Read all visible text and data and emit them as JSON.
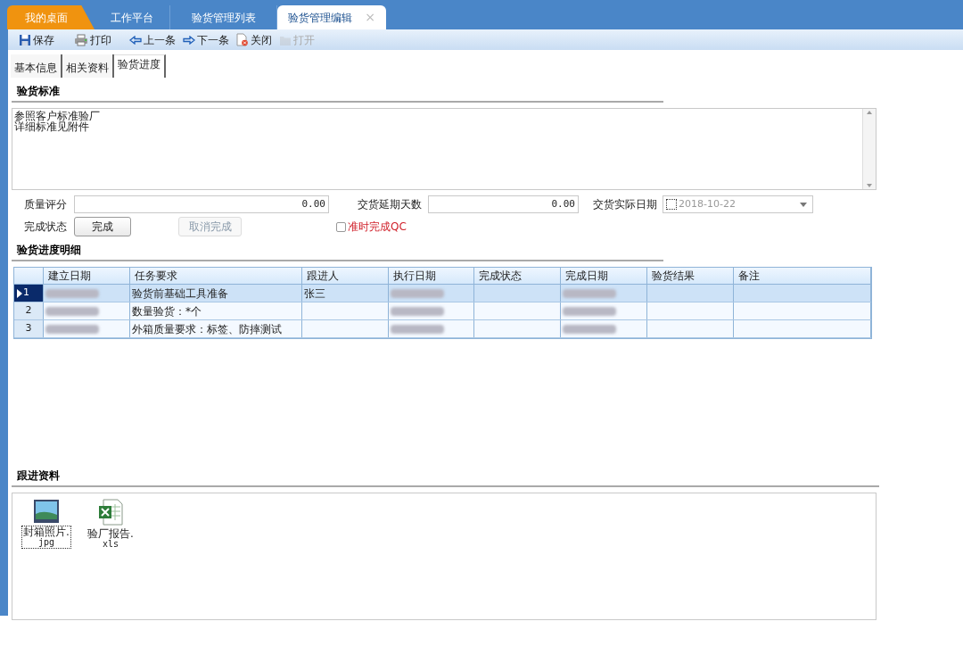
{
  "tabs": [
    {
      "label": "我的桌面",
      "kind": "home",
      "selected": false
    },
    {
      "label": "工作平台",
      "kind": "normal",
      "selected": false
    },
    {
      "label": "验货管理列表",
      "kind": "normal",
      "selected": false
    },
    {
      "label": "验货管理编辑",
      "kind": "normal",
      "selected": true,
      "close": "×"
    }
  ],
  "toolbar": [
    {
      "label": "保存",
      "kind": "save",
      "disabled": false
    },
    {
      "label": "打印",
      "kind": "print",
      "disabled": false
    },
    {
      "label": "上一条",
      "kind": "prev",
      "disabled": false
    },
    {
      "label": "下一条",
      "kind": "next",
      "disabled": false
    },
    {
      "label": "关闭",
      "kind": "close",
      "disabled": false
    },
    {
      "label": "打开",
      "kind": "open",
      "disabled": true
    }
  ],
  "form_tabs": [
    {
      "label": "基本信息",
      "selected": false
    },
    {
      "label": "相关资料",
      "selected": false
    },
    {
      "label": "验货进度",
      "selected": true
    }
  ],
  "standard": {
    "title": "验货标准",
    "lines": [
      "参照客户标准验厂",
      "详细标准见附件"
    ]
  },
  "fields": {
    "quality_label": "质量评分",
    "quality_value": "0.00",
    "delay_label": "交货延期天数",
    "delay_value": "0.00",
    "date_label": "交货实际日期",
    "date_checked": false,
    "date_value": "2018-10-22",
    "status_label": "完成状态",
    "complete_button": {
      "label": "完成",
      "disabled": false
    },
    "cancel_button": {
      "label": "取消完成",
      "disabled": true
    },
    "qc_checkbox": {
      "label": "准时完成QC",
      "checked": false
    }
  },
  "progress": {
    "title": "验货进度明细",
    "columns": [
      "建立日期",
      "任务要求",
      "跟进人",
      "执行日期",
      "完成状态",
      "完成日期",
      "验货结果",
      "备注"
    ],
    "rows": [
      {
        "number": "1",
        "selected": true,
        "cells": [
          {
            "kind": "redacted"
          },
          {
            "kind": "text",
            "text": "验货前基础工具准备"
          },
          {
            "kind": "text",
            "text": "张三"
          },
          {
            "kind": "redacted"
          },
          {
            "kind": "empty"
          },
          {
            "kind": "redacted"
          },
          {
            "kind": "empty"
          },
          {
            "kind": "empty"
          }
        ]
      },
      {
        "number": "2",
        "selected": false,
        "cells": [
          {
            "kind": "redacted"
          },
          {
            "kind": "text",
            "text": "数量验货：*个"
          },
          {
            "kind": "empty"
          },
          {
            "kind": "redacted"
          },
          {
            "kind": "empty"
          },
          {
            "kind": "redacted"
          },
          {
            "kind": "empty"
          },
          {
            "kind": "empty"
          }
        ]
      },
      {
        "number": "3",
        "selected": false,
        "cells": [
          {
            "kind": "redacted"
          },
          {
            "kind": "text",
            "text": "外箱质量要求：标签、防摔测试"
          },
          {
            "kind": "empty"
          },
          {
            "kind": "redacted"
          },
          {
            "kind": "empty"
          },
          {
            "kind": "redacted"
          },
          {
            "kind": "empty"
          },
          {
            "kind": "empty"
          }
        ]
      }
    ]
  },
  "attachments": {
    "title": "跟进资料",
    "files": [
      {
        "kind": "image",
        "name": "封箱照片.",
        "ext": "jpg",
        "selected": true
      },
      {
        "kind": "excel",
        "name": "验厂报告.",
        "ext": "xls",
        "selected": false
      }
    ]
  }
}
